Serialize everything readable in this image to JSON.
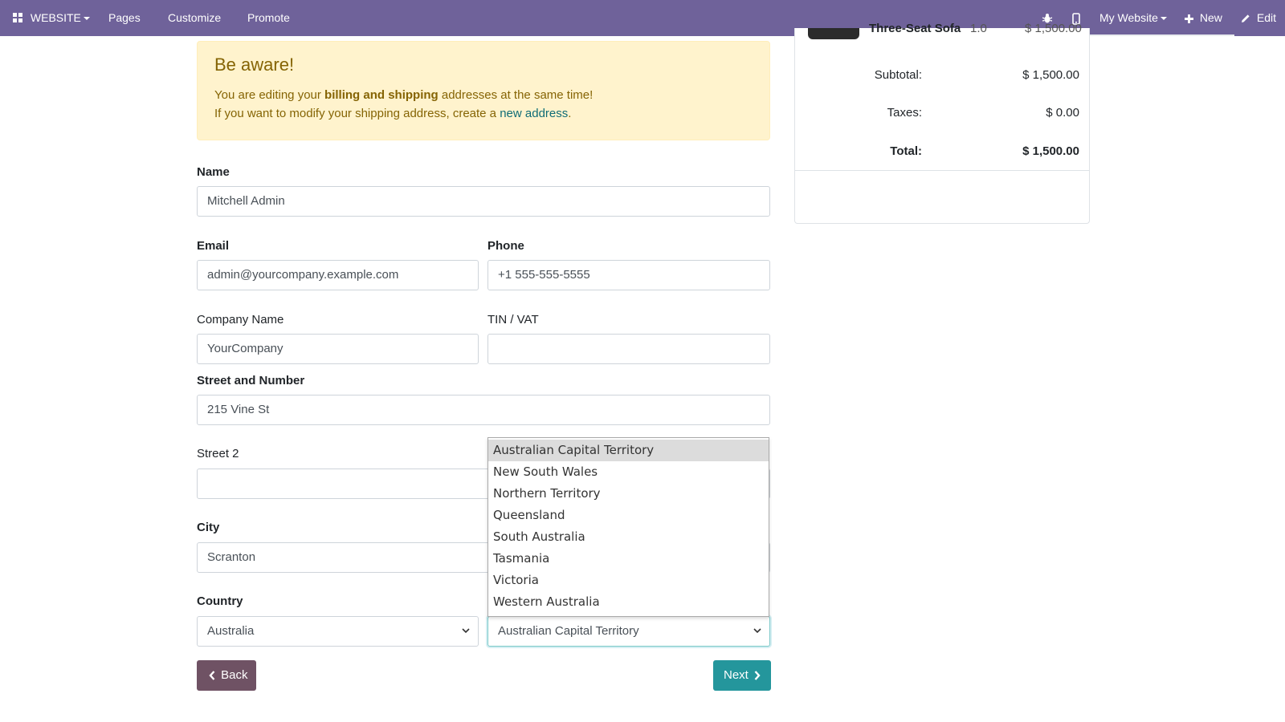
{
  "navbar": {
    "app_menu": "WEBSITE",
    "items": [
      "Pages",
      "Customize",
      "Promote"
    ],
    "website_menu": "My Website",
    "new_label": "New",
    "edit_label": "Edit"
  },
  "alert": {
    "title": "Be aware!",
    "line1_pre": "You are editing your ",
    "line1_bold": "billing and shipping",
    "line1_post": " addresses at the same time!",
    "line2_pre": "If you want to modify your shipping address, create a ",
    "line2_link": "new address",
    "line2_post": "."
  },
  "form": {
    "name_label": "Name",
    "name_value": "Mitchell Admin",
    "email_label": "Email",
    "email_value": "admin@yourcompany.example.com",
    "phone_label": "Phone",
    "phone_value": "+1 555-555-5555",
    "company_label": "Company Name",
    "company_value": "YourCompany",
    "vat_label": "TIN / VAT",
    "vat_value": "",
    "street_label": "Street and Number",
    "street_value": "215 Vine St",
    "street2_label": "Street 2",
    "street2_value": "",
    "city_label": "City",
    "city_value": "Scranton",
    "country_label": "Country",
    "country_value": "Australia",
    "state_value": "Australian Capital Territory"
  },
  "state_options": [
    "Australian Capital Territory",
    "New South Wales",
    "Northern Territory",
    "Queensland",
    "South Australia",
    "Tasmania",
    "Victoria",
    "Western Australia"
  ],
  "buttons": {
    "back": "Back",
    "next": "Next"
  },
  "summary": {
    "product_name": "Three-Seat Sofa",
    "product_qty": "1.0",
    "product_price": "$ 1,500.00",
    "subtotal_label": "Subtotal:",
    "subtotal_value": "$ 1,500.00",
    "taxes_label": "Taxes:",
    "taxes_value": "$ 0.00",
    "total_label": "Total:",
    "total_value": "$ 1,500.00"
  },
  "colors": {
    "navbar": "#6f629a",
    "alert_bg": "#fff3cd",
    "alert_text": "#856404",
    "back_button": "#6f5264",
    "next_button": "#24969c"
  }
}
